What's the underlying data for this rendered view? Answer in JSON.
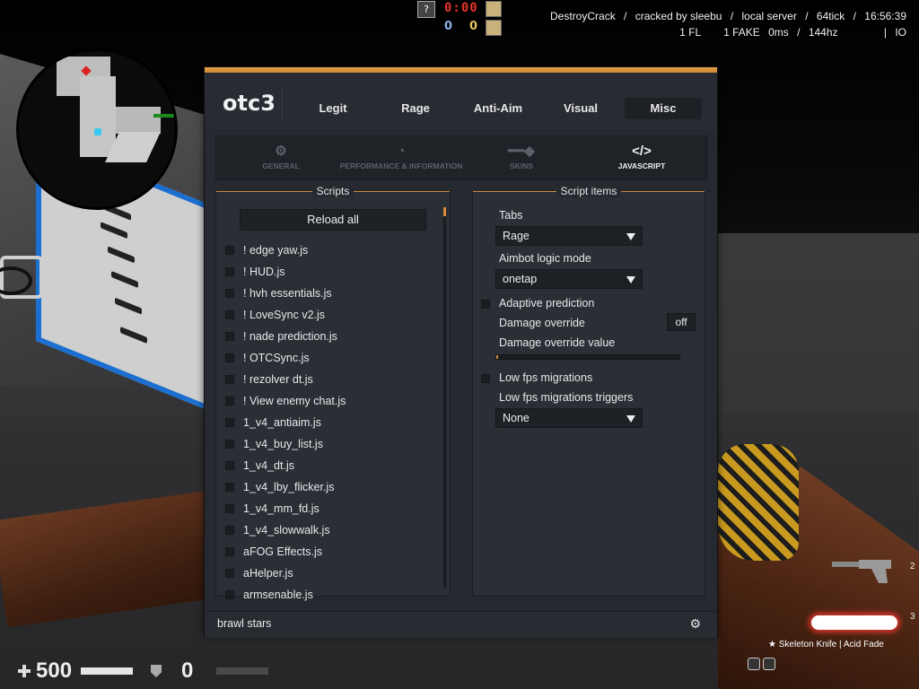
{
  "watermark": {
    "row1": [
      "DestroyCrack",
      "/",
      "cracked by sleebu",
      "/",
      "local server",
      "/",
      "64tick",
      "/",
      "16:56:39"
    ],
    "row2": [
      "1 FL",
      "1 FAKE",
      "0ms",
      "/",
      "144hz",
      "|",
      "IO"
    ]
  },
  "scoreboard": {
    "help": "?",
    "timer": "0:00",
    "ct_score": "0",
    "t_score": "0"
  },
  "hud": {
    "health": "500",
    "armor": "0",
    "slot_pistol": "2",
    "slot_knife": "3",
    "knife_name": "★ Skeleton Knife | Acid Fade"
  },
  "menu": {
    "brand": "otc3",
    "tabs": [
      {
        "label": "Legit"
      },
      {
        "label": "Rage"
      },
      {
        "label": "Anti-Aim"
      },
      {
        "label": "Visual"
      },
      {
        "label": "Misc"
      }
    ],
    "active_tab": "Misc",
    "subtabs": [
      {
        "label": "GENERAL",
        "icon": "gear-icon"
      },
      {
        "label": "PERFORMANCE & INFORMATION",
        "icon": "gauge-icon"
      },
      {
        "label": "SKINS",
        "icon": "knife-icon"
      },
      {
        "label": "JAVASCRIPT",
        "icon": "code-icon"
      }
    ],
    "active_subtab": "JAVASCRIPT",
    "accent_color": "#d98a3a",
    "scripts_panel": {
      "title": "Scripts",
      "reload_label": "Reload all",
      "items": [
        "! edge yaw.js",
        "! HUD.js",
        "! hvh essentials.js",
        "! LoveSync v2.js",
        "! nade prediction.js",
        "! OTCSync.js",
        "! rezolver dt.js",
        "! View enemy chat.js",
        "1_v4_antiaim.js",
        "1_v4_buy_list.js",
        "1_v4_dt.js",
        "1_v4_lby_flicker.js",
        "1_v4_mm_fd.js",
        "1_v4_slowwalk.js",
        "aFOG Effects.js",
        "aHelper.js",
        "armsenable.js"
      ]
    },
    "items_panel": {
      "title": "Script items",
      "tabs_label": "Tabs",
      "tabs_value": "Rage",
      "aimbot_label": "Aimbot logic mode",
      "aimbot_value": "onetap",
      "adaptive_label": "Adaptive prediction",
      "damage_override_label": "Damage override",
      "damage_override_key": "off",
      "damage_value_label": "Damage override value",
      "damage_value_fraction": 0.01,
      "lowfps_label": "Low fps migrations",
      "lowfps_triggers_label": "Low fps migrations triggers",
      "lowfps_triggers_value": "None"
    },
    "footer": {
      "text": "brawl stars"
    }
  }
}
